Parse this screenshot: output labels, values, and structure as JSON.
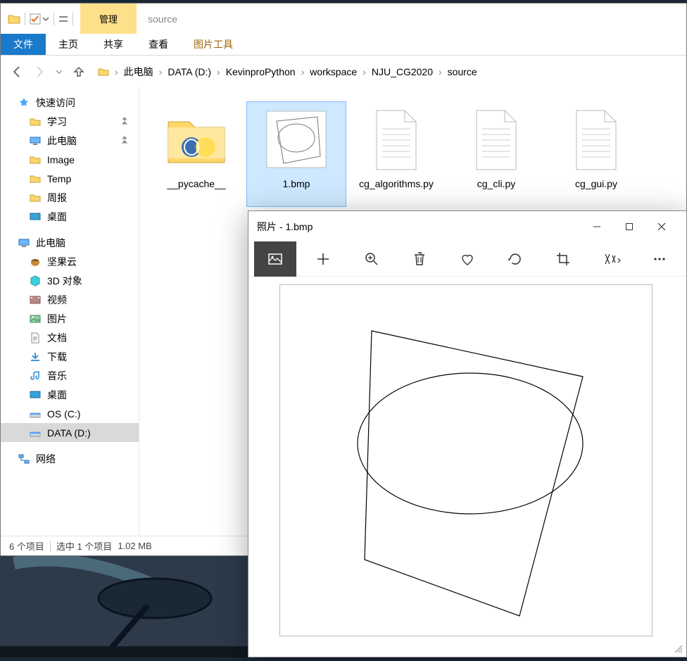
{
  "explorer": {
    "title_manage": "管理",
    "title_subtitle": "图片工具",
    "title_context": "source",
    "ribbon": {
      "file": "文件",
      "home": "主页",
      "share": "共享",
      "view": "查看",
      "image_tools": "图片工具"
    },
    "breadcrumb": [
      "此电脑",
      "DATA (D:)",
      "KevinproPython",
      "workspace",
      "NJU_CG2020",
      "source"
    ],
    "sidebar": {
      "quick_access": "快速访问",
      "quick_items": [
        {
          "label": "学习",
          "pinned": true,
          "icon": "folder"
        },
        {
          "label": "此电脑",
          "pinned": true,
          "icon": "pc"
        },
        {
          "label": "Image",
          "pinned": false,
          "icon": "folder"
        },
        {
          "label": "Temp",
          "pinned": false,
          "icon": "folder"
        },
        {
          "label": "周报",
          "pinned": false,
          "icon": "folder"
        },
        {
          "label": "桌面",
          "pinned": false,
          "icon": "desktop"
        }
      ],
      "this_pc": "此电脑",
      "pc_items": [
        {
          "label": "坚果云",
          "icon": "nut"
        },
        {
          "label": "3D 对象",
          "icon": "cube"
        },
        {
          "label": "视频",
          "icon": "video"
        },
        {
          "label": "图片",
          "icon": "pictures"
        },
        {
          "label": "文档",
          "icon": "docs"
        },
        {
          "label": "下载",
          "icon": "download"
        },
        {
          "label": "音乐",
          "icon": "music"
        },
        {
          "label": "桌面",
          "icon": "desktop"
        },
        {
          "label": "OS (C:)",
          "icon": "drive"
        },
        {
          "label": "DATA (D:)",
          "icon": "drive",
          "selected": true
        }
      ],
      "network": "网络"
    },
    "files": [
      {
        "name": "__pycache__",
        "type": "folder",
        "selected": false
      },
      {
        "name": "1.bmp",
        "type": "bmp",
        "selected": true
      },
      {
        "name": "cg_algorithms.py",
        "type": "py",
        "selected": false
      },
      {
        "name": "cg_cli.py",
        "type": "py",
        "selected": false
      },
      {
        "name": "cg_gui.py",
        "type": "py",
        "selected": false
      }
    ],
    "status": {
      "count": "6 个项目",
      "selection": "选中 1 个项目",
      "size": "1.02 MB"
    }
  },
  "photos": {
    "title": "照片 - 1.bmp"
  }
}
